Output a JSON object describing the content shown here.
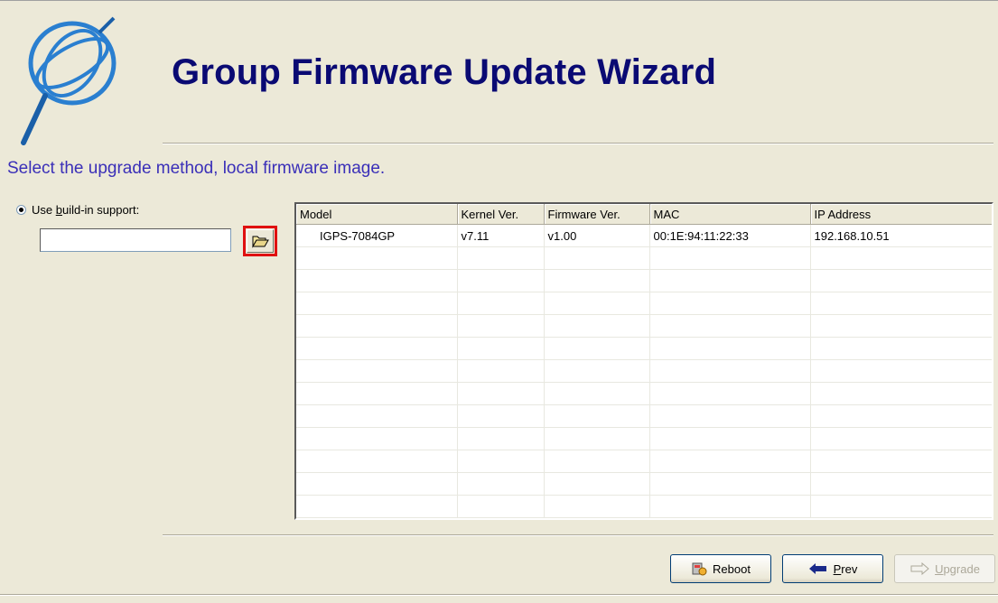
{
  "header": {
    "title": "Group Firmware Update Wizard"
  },
  "instructions": "Select the upgrade method, local firmware image.",
  "source": {
    "radio_label_pre": "Use ",
    "radio_label_key": "b",
    "radio_label_post": "uild-in support:",
    "path_value": ""
  },
  "table": {
    "columns": [
      "Model",
      "Kernel Ver.",
      "Firmware Ver.",
      "MAC",
      "IP Address"
    ],
    "rows": [
      [
        "IGPS-7084GP",
        "v7.11",
        "v1.00",
        "00:1E:94:11:22:33",
        "192.168.10.51"
      ]
    ],
    "empty_rows": 12
  },
  "buttons": {
    "reboot": "Reboot",
    "prev_key": "P",
    "prev_rest": "rev",
    "upgrade_key": "U",
    "upgrade_rest": "pgrade"
  },
  "icons": {
    "logo": "globe-magnifier-logo",
    "browse": "folder-open-icon",
    "reboot": "reboot-icon",
    "prev": "arrow-left-icon",
    "upgrade": "arrow-right-icon"
  },
  "colors": {
    "title": "#0a0a73",
    "subtitle": "#3a2fb8",
    "highlight": "#e01010"
  }
}
